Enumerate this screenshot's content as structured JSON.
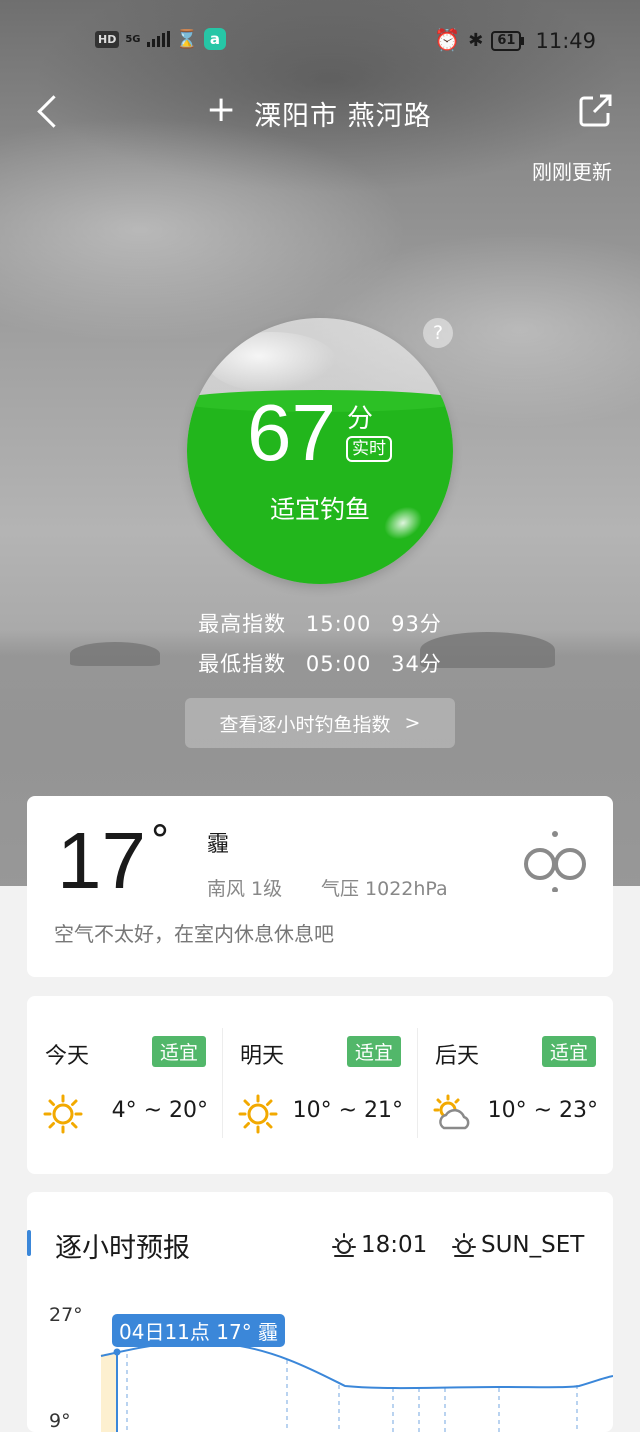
{
  "status_bar": {
    "left_badge": "HD",
    "signal": "5G",
    "app_icon": "a",
    "battery": "61",
    "time": "11:49",
    "icons": [
      "hd-icon",
      "signal-icon",
      "hourglass-icon",
      "app-icon",
      "alarm-icon",
      "bluetooth-icon",
      "battery-icon"
    ]
  },
  "header": {
    "location": "溧阳市 燕河路",
    "updated": "刚刚更新",
    "help": "?"
  },
  "index": {
    "score": "67",
    "unit": "分",
    "realtime": "实时",
    "fill_fraction": 0.67,
    "level": "适宜钓鱼",
    "high": {
      "label": "最高指数",
      "time": "15:00",
      "value": "93分"
    },
    "low": {
      "label": "最低指数",
      "time": "05:00",
      "value": "34分"
    },
    "hourly_button": "查看逐小时钓鱼指数",
    "hourly_button_arrow": ">"
  },
  "current": {
    "temp": "17",
    "deg": "°",
    "condition": "霾",
    "wind": "南风  1级",
    "pressure": "气压  1022hPa",
    "tip": "空气不太好，在室内休息休息吧"
  },
  "forecast": [
    {
      "day": "今天",
      "tag": "适宜",
      "range": "4° ~ 20°",
      "icon": "sun-icon"
    },
    {
      "day": "明天",
      "tag": "适宜",
      "range": "10° ~ 21°",
      "icon": "sun-icon"
    },
    {
      "day": "后天",
      "tag": "适宜",
      "range": "10° ~ 23°",
      "icon": "partly-cloudy-icon"
    }
  ],
  "hourly": {
    "title": "逐小时预报",
    "sunrise": "18:01",
    "sunset": "SUN_SET",
    "y_max": "27°",
    "y_min": "9°",
    "tooltip": "04日11点 17° 霾"
  },
  "colors": {
    "accent_green": "#22b61c",
    "tag_green": "#52b76a",
    "accent_blue": "#3b87d9"
  }
}
